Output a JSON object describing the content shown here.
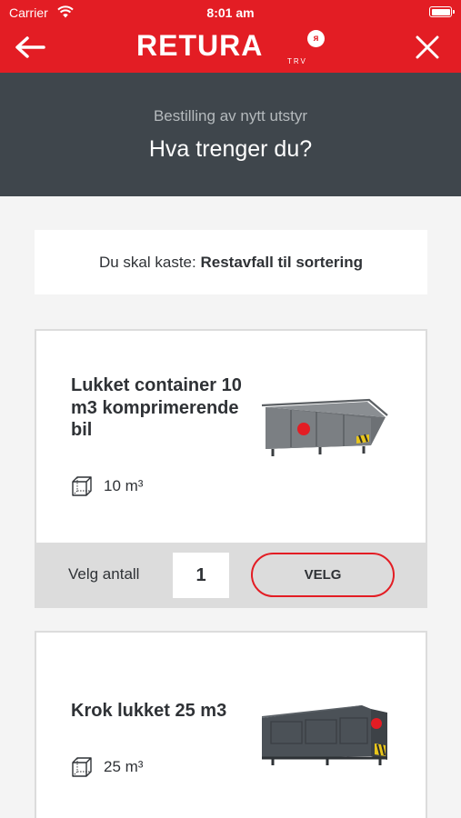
{
  "status_bar": {
    "carrier": "Carrier",
    "time": "8:01 am",
    "battery_level": 1.0
  },
  "nav": {
    "logo_text": "RETURA",
    "logo_badge": "ᴙ",
    "logo_sub": "TRV",
    "back_icon": "arrow-left-icon",
    "close_icon": "close-icon",
    "brand_color": "#e31d24"
  },
  "header": {
    "subtitle": "Bestilling av nytt utstyr",
    "title": "Hva trenger du?",
    "background": "#3f464c"
  },
  "waste": {
    "label": "Du skal kaste:",
    "value": "Restavfall til sortering"
  },
  "products": [
    {
      "name": "Lukket container 10 m3 komprimerende bil",
      "volume": "10 m³",
      "volume_icon": "cube-icon",
      "quantity_label": "Velg antall",
      "quantity": "1",
      "select_label": "VELG"
    },
    {
      "name": "Krok lukket 25 m3",
      "volume": "25 m³",
      "volume_icon": "cube-icon"
    }
  ]
}
